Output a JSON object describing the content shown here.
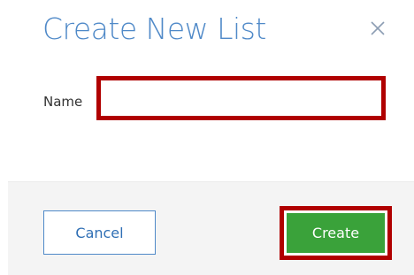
{
  "dialog": {
    "title": "Create New List",
    "close_icon": "close-icon"
  },
  "form": {
    "name_label": "Name",
    "name_value": "",
    "name_placeholder": ""
  },
  "footer": {
    "cancel_label": "Cancel",
    "create_label": "Create"
  },
  "colors": {
    "title": "#4f89c8",
    "create_button": "#3aa23a",
    "highlight_border": "#b00000",
    "footer_background": "#f4f4f4"
  }
}
